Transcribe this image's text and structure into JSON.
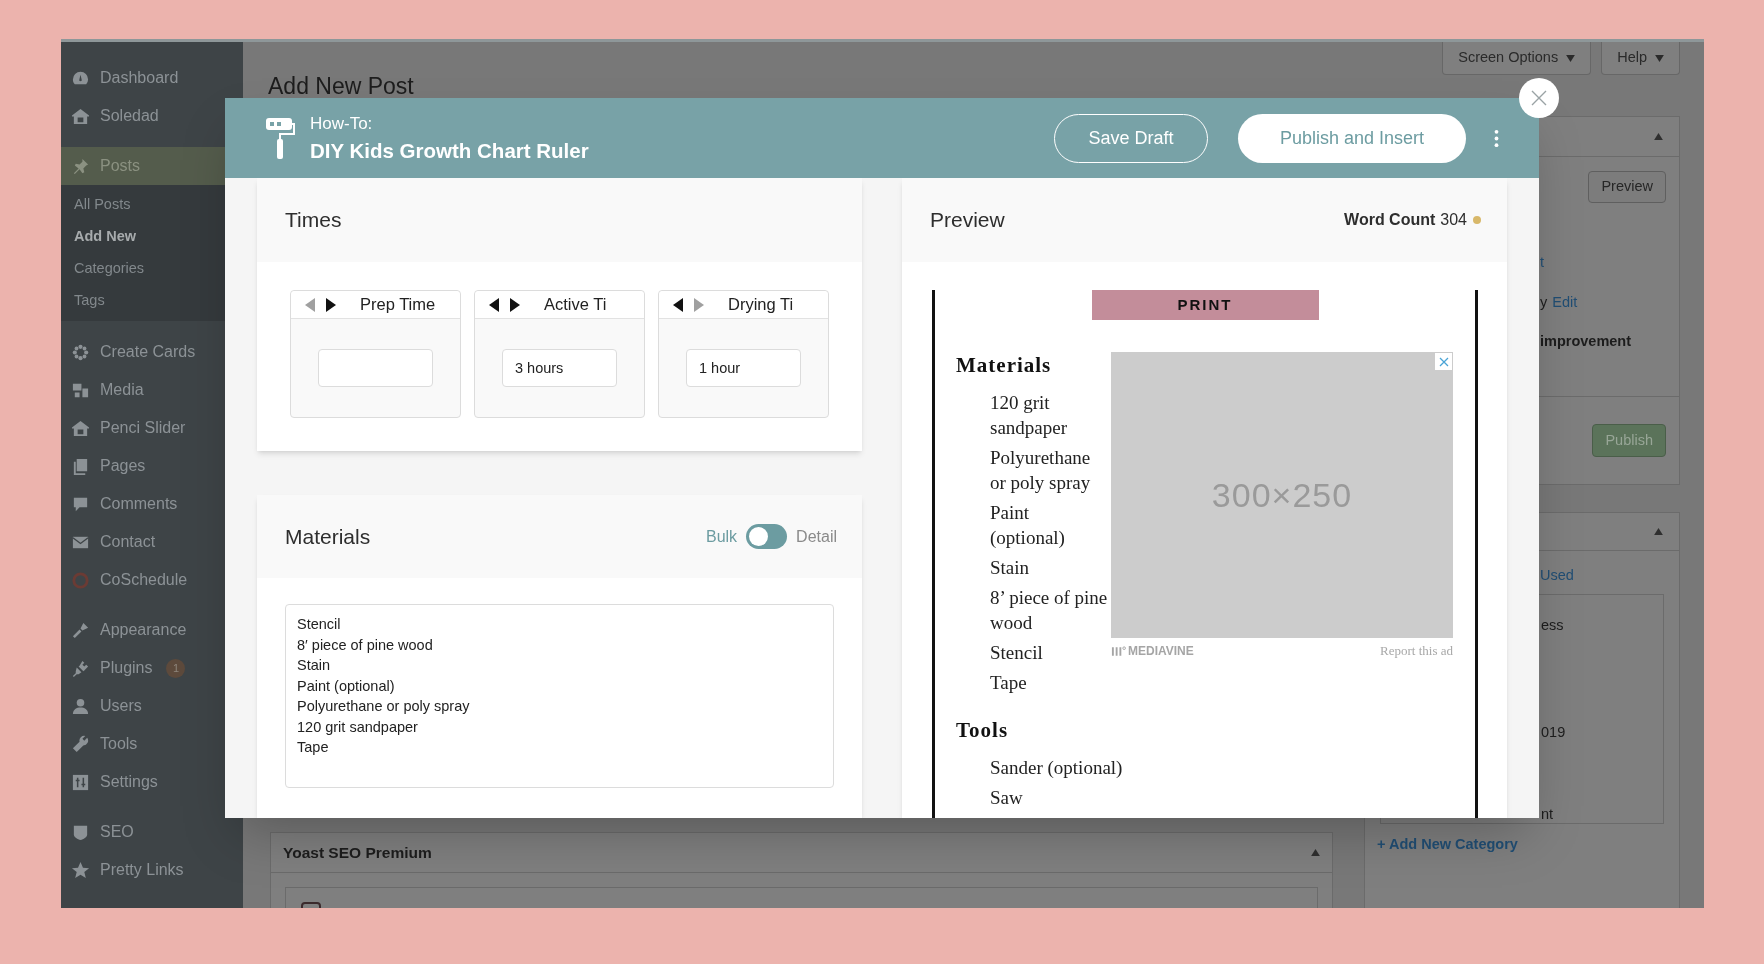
{
  "sidebar": {
    "groups": [
      {
        "items": [
          {
            "label": "Dashboard",
            "selected": false
          },
          {
            "label": "Soledad",
            "selected": false
          }
        ]
      },
      {
        "items": [
          {
            "label": "Posts",
            "selected": true,
            "children": [
              {
                "label": "All Posts",
                "selected": false
              },
              {
                "label": "Add New",
                "selected": true
              },
              {
                "label": "Categories",
                "selected": false
              },
              {
                "label": "Tags",
                "selected": false
              }
            ]
          }
        ]
      },
      {
        "items": [
          {
            "label": "Create Cards",
            "selected": false
          },
          {
            "label": "Media",
            "selected": false
          },
          {
            "label": "Penci Slider",
            "selected": false
          },
          {
            "label": "Pages",
            "selected": false
          },
          {
            "label": "Comments",
            "selected": false
          },
          {
            "label": "Contact",
            "selected": false
          },
          {
            "label": "CoSchedule",
            "selected": false
          }
        ]
      },
      {
        "items": [
          {
            "label": "Appearance",
            "selected": false
          },
          {
            "label": "Plugins",
            "selected": false,
            "badge": "1"
          },
          {
            "label": "Users",
            "selected": false
          },
          {
            "label": "Tools",
            "selected": false
          },
          {
            "label": "Settings",
            "selected": false
          }
        ]
      },
      {
        "items": [
          {
            "label": "SEO",
            "selected": false
          },
          {
            "label": "Pretty Links",
            "selected": false
          }
        ]
      }
    ]
  },
  "page": {
    "title": "Add New Post",
    "screen_options": "Screen Options",
    "help": "Help"
  },
  "publish_box": {
    "preview_button": "Preview",
    "lines": [
      [
        {
          "text": "t",
          "kind": "link"
        }
      ],
      [
        {
          "text": "y",
          "kind": "plain"
        },
        {
          "text": "Edit",
          "kind": "link"
        }
      ],
      [
        {
          "text": "improvement",
          "kind": "bold"
        }
      ]
    ],
    "publish_button": "Publish"
  },
  "categories_box": {
    "tab_link": "Used",
    "list_fragments": [
      "ess",
      "019",
      "nt"
    ],
    "add_link": "+ Add New Category"
  },
  "yoast_panel": {
    "title": "Yoast SEO Premium"
  },
  "modal": {
    "type_label": "How-To:",
    "title": "DIY Kids Growth Chart Ruler",
    "save_button": "Save Draft",
    "publish_button": "Publish and Insert",
    "times": {
      "title": "Times",
      "slots": [
        {
          "label": "Prep Time",
          "prev_enabled": false,
          "next_enabled": true
        },
        {
          "label": "Active Ti",
          "value": "3 hours",
          "prev_enabled": true,
          "next_enabled": true
        },
        {
          "label": "Drying Ti",
          "value": "1 hour",
          "prev_enabled": true,
          "next_enabled": false
        }
      ]
    },
    "materials": {
      "title": "Materials",
      "toggle_left": "Bulk",
      "toggle_right": "Detail",
      "detail_on": false,
      "value": "Stencil\n8′ piece of pine wood\nStain\nPaint (optional)\nPolyurethane or poly spray\n120 grit sandpaper\nTape"
    },
    "preview": {
      "title": "Preview",
      "word_count_label": "Word Count",
      "word_count": "304",
      "print_button": "PRINT",
      "sections": [
        {
          "heading": "Materials",
          "items": [
            "120 grit sandpaper",
            "Polyurethane or poly spray",
            "Paint (optional)",
            "Stain",
            "8’ piece of pine wood",
            "Stencil",
            "Tape"
          ]
        },
        {
          "heading": "Tools",
          "items": [
            "Sander (optional)",
            "Saw"
          ]
        }
      ],
      "ad": {
        "size_label": "300×250",
        "brand": "MEDIAVINE",
        "report": "Report this ad"
      }
    }
  }
}
